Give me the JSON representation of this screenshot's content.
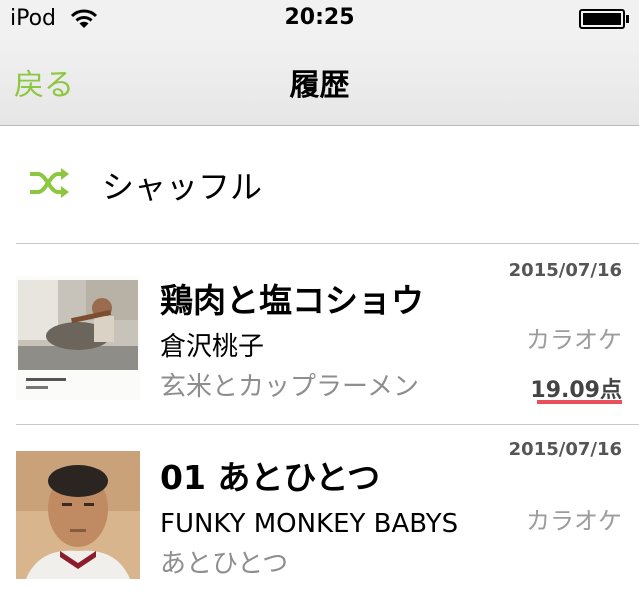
{
  "status_bar": {
    "carrier": "iPod",
    "time": "20:25"
  },
  "nav": {
    "back_label": "戻る",
    "title": "履歴",
    "accent_color": "#8dc63f"
  },
  "shuffle": {
    "icon": "shuffle-icon",
    "label": "シャッフル"
  },
  "history": [
    {
      "song": "鶏肉と塩コショウ",
      "artist": "倉沢桃子",
      "album": "玄米とカップラーメン",
      "date": "2015/07/16",
      "kind": "カラオケ",
      "score": "19.09点"
    },
    {
      "song": "01 あとひとつ",
      "artist": "FUNKY MONKEY BABYS",
      "album": "あとひとつ",
      "date": "2015/07/16",
      "kind": "カラオケ"
    }
  ]
}
